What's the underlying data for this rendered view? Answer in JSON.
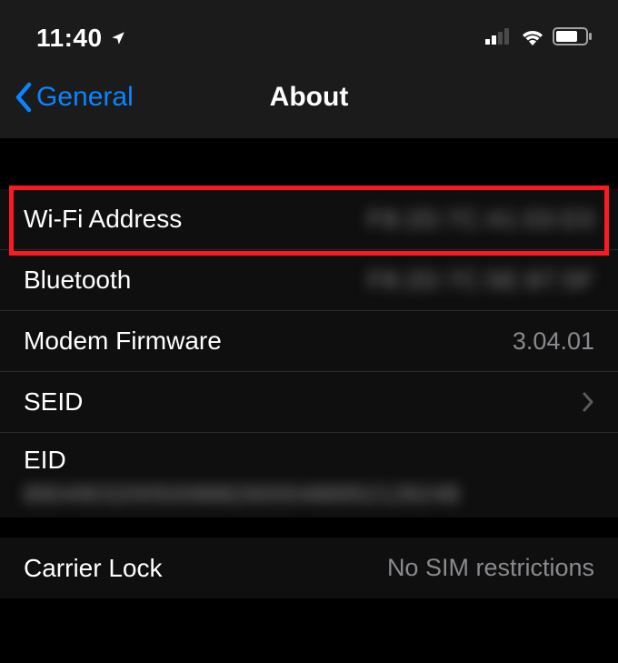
{
  "status_bar": {
    "time": "11:40"
  },
  "nav": {
    "back_label": "General",
    "title": "About"
  },
  "rows": {
    "wifi": {
      "label": "Wi-Fi Address",
      "value": "F8:2D:7C:41:03:D3"
    },
    "bluetooth": {
      "label": "Bluetooth",
      "value": "F8:2D:7C:5E:87:5F"
    },
    "modem": {
      "label": "Modem Firmware",
      "value": "3.04.01"
    },
    "seid": {
      "label": "SEID"
    },
    "eid": {
      "label": "EID",
      "value": "89049032005008882600048895212824B"
    },
    "carrier_lock": {
      "label": "Carrier Lock",
      "value": "No SIM restrictions"
    }
  }
}
